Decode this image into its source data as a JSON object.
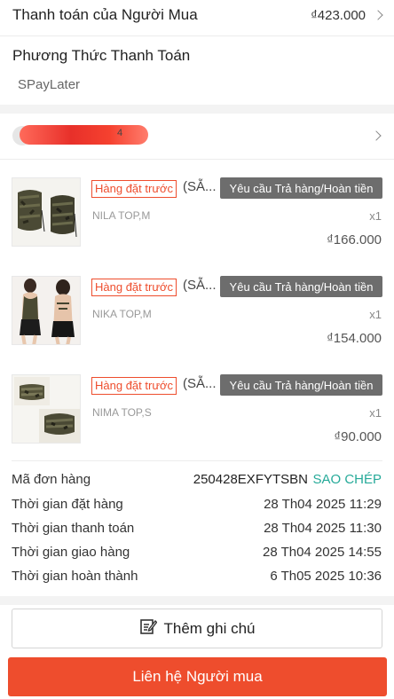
{
  "total": {
    "label": "Thanh toán của Người Mua",
    "amount": "₫423.000"
  },
  "payment": {
    "title": "Phương Thức Thanh Toán",
    "method": "SPayLater"
  },
  "buyer": {
    "name_tail": "4"
  },
  "items": [
    {
      "tag": "Hàng đặt trước",
      "name": "(SẴ...",
      "return_label": "Yêu cầu Trả hàng/Hoàn tiền",
      "variant": "NILA TOP,M",
      "qty": "x1",
      "price": "₫166.000"
    },
    {
      "tag": "Hàng đặt trước",
      "name": "(SẴ...",
      "return_label": "Yêu cầu Trả hàng/Hoàn tiền",
      "variant": "NIKA TOP,M",
      "qty": "x1",
      "price": "₫154.000"
    },
    {
      "tag": "Hàng đặt trước",
      "name": "(SẴ...",
      "return_label": "Yêu cầu Trả hàng/Hoàn tiền",
      "variant": "NIMA TOP,S",
      "qty": "x1",
      "price": "₫90.000"
    }
  ],
  "order": {
    "id_label": "Mã đơn hàng",
    "id": "250428EXFYTSBN",
    "copy_label": "SAO CHÉP",
    "rows": [
      {
        "label": "Thời gian đặt hàng",
        "value": "28 Th04 2025 11:29"
      },
      {
        "label": "Thời gian thanh toán",
        "value": "28 Th04 2025 11:30"
      },
      {
        "label": "Thời gian giao hàng",
        "value": "28 Th04 2025 14:55"
      },
      {
        "label": "Thời gian hoàn thành",
        "value": "6 Th05 2025 10:36"
      }
    ]
  },
  "actions": {
    "note_label": "Thêm ghi chú",
    "contact_label": "Liên hệ Người mua"
  },
  "colors": {
    "accent": "#ee4d2d",
    "copy": "#26aa99",
    "return_button": "#6d6d6d"
  },
  "icons": {
    "chevron": "chevron-right-icon",
    "note": "edit-note-icon"
  }
}
